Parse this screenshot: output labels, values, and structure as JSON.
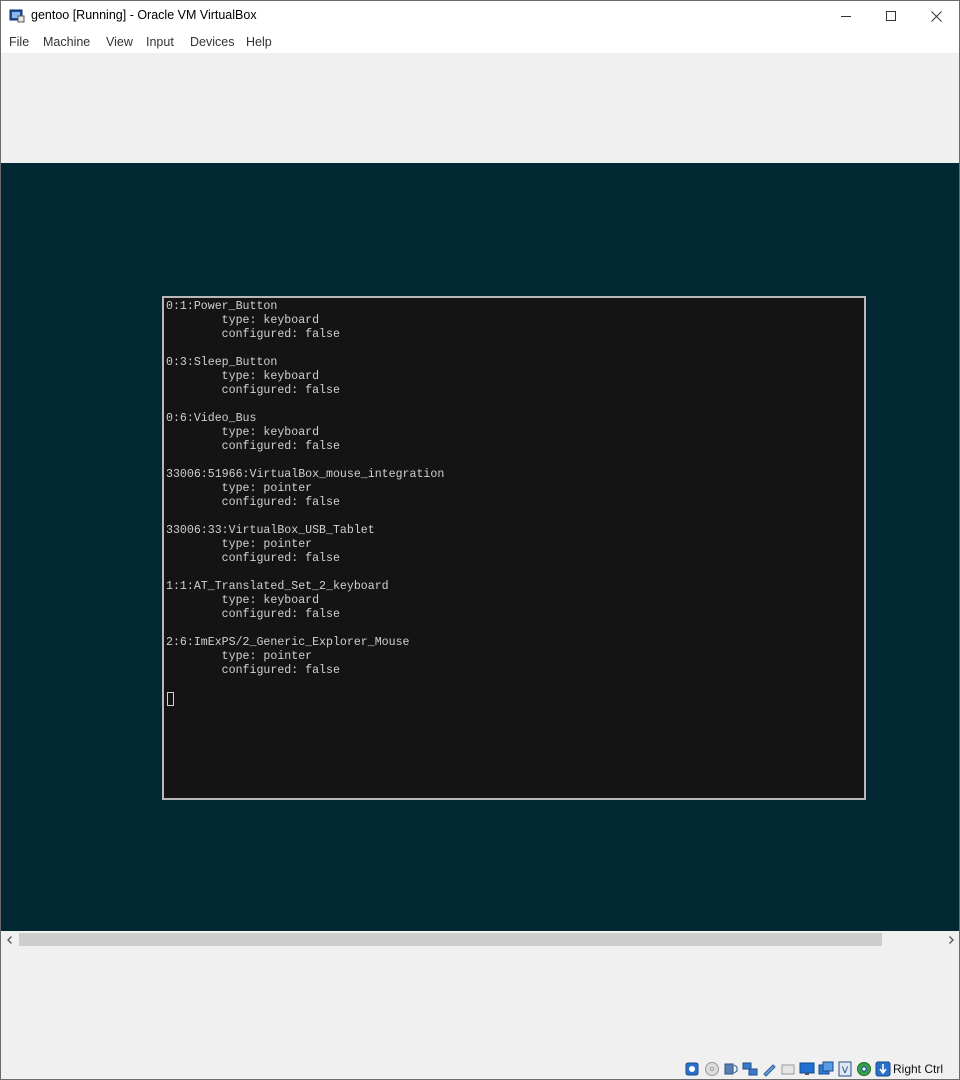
{
  "window": {
    "title": "gentoo [Running] - Oracle VM VirtualBox"
  },
  "menubar": {
    "items": [
      {
        "label": "File"
      },
      {
        "label": "Machine"
      },
      {
        "label": "View"
      },
      {
        "label": "Input"
      },
      {
        "label": "Devices"
      },
      {
        "label": "Help"
      }
    ]
  },
  "console": {
    "lines": [
      "0:1:Power_Button",
      "        type: keyboard",
      "        configured: false",
      "",
      "0:3:Sleep_Button",
      "        type: keyboard",
      "        configured: false",
      "",
      "0:6:Video_Bus",
      "        type: keyboard",
      "        configured: false",
      "",
      "33006:51966:VirtualBox_mouse_integration",
      "        type: pointer",
      "        configured: false",
      "",
      "33006:33:VirtualBox_USB_Tablet",
      "        type: pointer",
      "        configured: false",
      "",
      "1:1:AT_Translated_Set_2_keyboard",
      "        type: keyboard",
      "        configured: false",
      "",
      "2:6:ImExPS/2_Generic_Explorer_Mouse",
      "        type: pointer",
      "        configured: false"
    ]
  },
  "statusbar": {
    "icons": [
      "hard-disk-icon",
      "optical-drive-icon",
      "audio-icon",
      "network-icon",
      "usb-icon",
      "shared-folders-icon",
      "display-icon",
      "video-capture-icon",
      "cpu-icon",
      "mouse-integration-icon",
      "keyboard-capture-icon"
    ],
    "host_key": "Right Ctrl"
  },
  "colors": {
    "vm_background": "#022833",
    "console_background": "#141414",
    "console_text": "#d0d0d0"
  }
}
